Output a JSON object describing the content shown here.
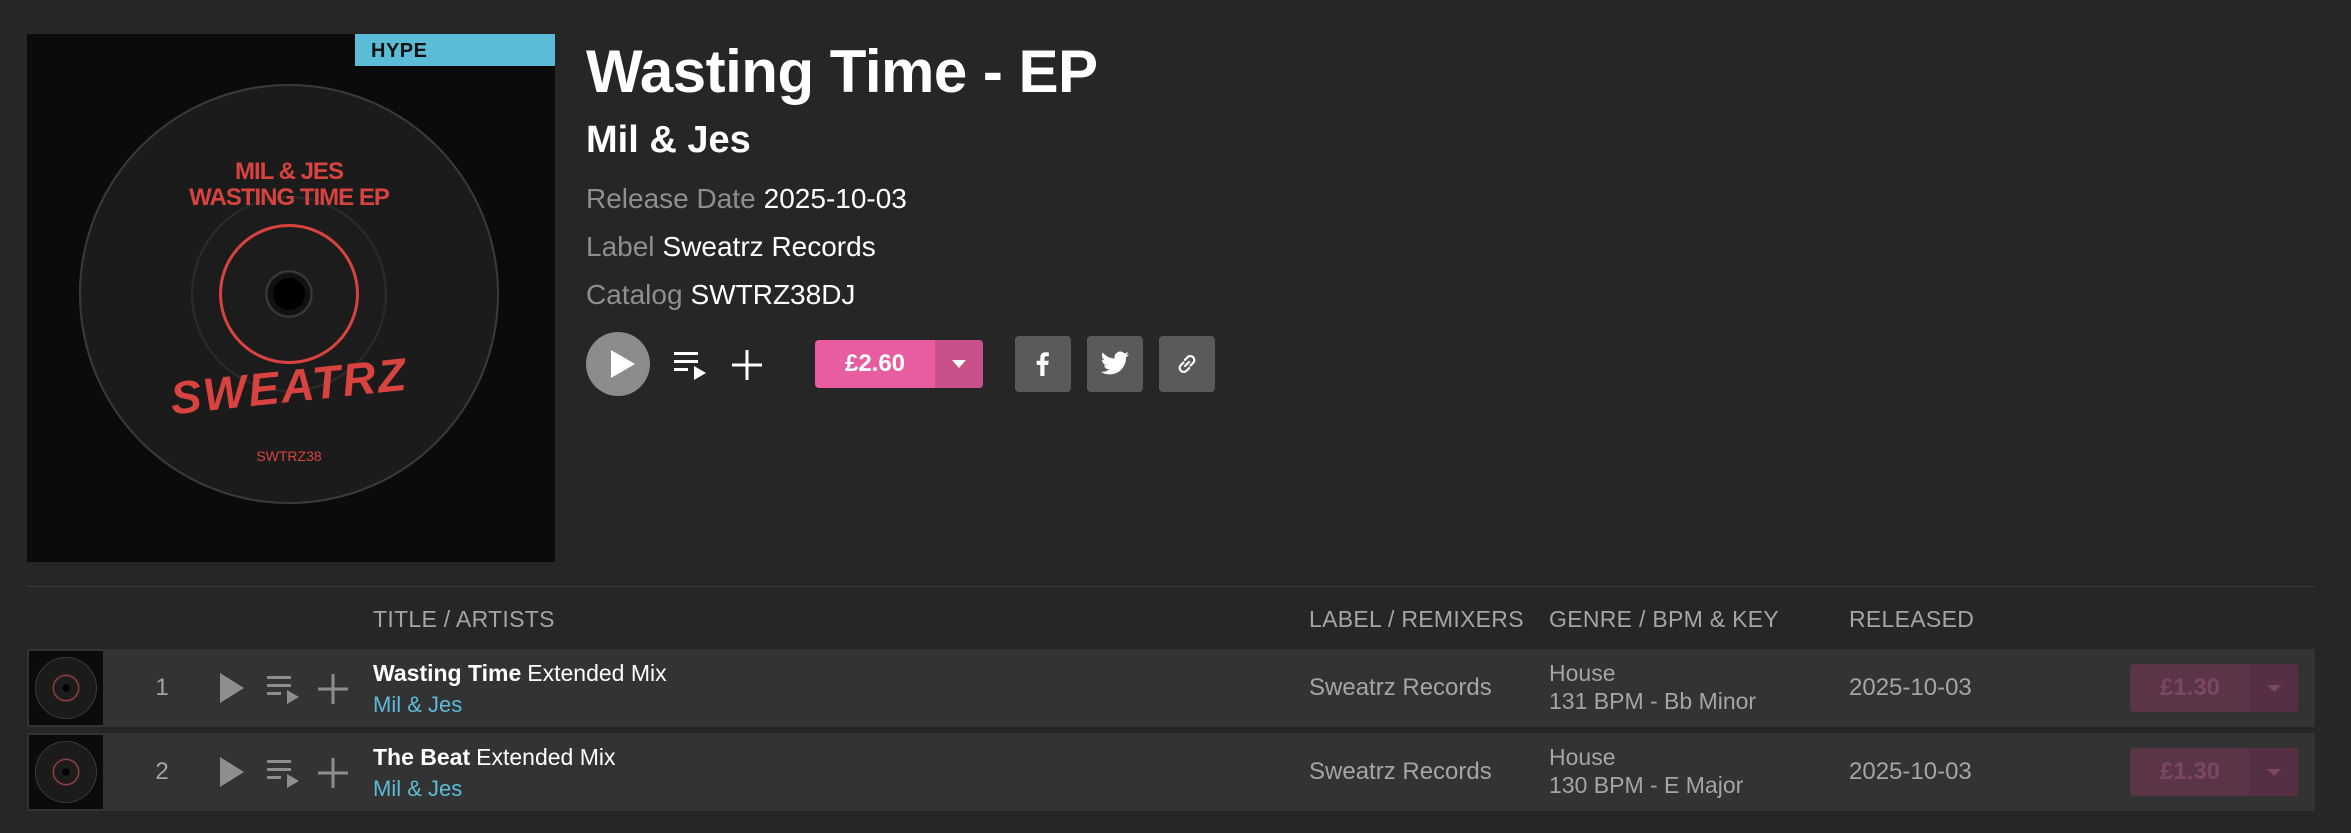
{
  "release": {
    "badge": "HYPE",
    "title": "Wasting Time - EP",
    "artist": "Mil & Jes",
    "release_date_label": "Release Date",
    "release_date": "2025-10-03",
    "label_label": "Label",
    "label": "Sweatrz Records",
    "catalog_label": "Catalog",
    "catalog": "SWTRZ38DJ",
    "price": "£2.60",
    "artwork": {
      "line1": "MIL & JES",
      "line2": "WASTING TIME EP",
      "logo": "SWEATRZ",
      "catalog": "SWTRZ38"
    }
  },
  "icons": {
    "play": "play-icon",
    "queue": "add-to-queue-icon",
    "add": "plus-icon",
    "facebook": "facebook-icon",
    "twitter": "twitter-icon",
    "link": "link-icon",
    "caret": "chevron-down-icon"
  },
  "colors": {
    "background": "#262626",
    "accent_pink": "#e85d9f",
    "artist_blue": "#5bbcd8",
    "hype_badge": "#5bbcd8"
  },
  "table": {
    "headers": {
      "title": "TITLE / ARTISTS",
      "label": "LABEL / REMIXERS",
      "genre": "GENRE / BPM & KEY",
      "released": "RELEASED"
    },
    "tracks": [
      {
        "number": "1",
        "title": "Wasting Time",
        "mix": "Extended Mix",
        "artist": "Mil & Jes",
        "label": "Sweatrz Records",
        "genre": "House",
        "bpm_key": "131 BPM - Bb Minor",
        "released": "2025-10-03",
        "price": "£1.30"
      },
      {
        "number": "2",
        "title": "The Beat",
        "mix": "Extended Mix",
        "artist": "Mil & Jes",
        "label": "Sweatrz Records",
        "genre": "House",
        "bpm_key": "130 BPM - E Major",
        "released": "2025-10-03",
        "price": "£1.30"
      }
    ]
  }
}
